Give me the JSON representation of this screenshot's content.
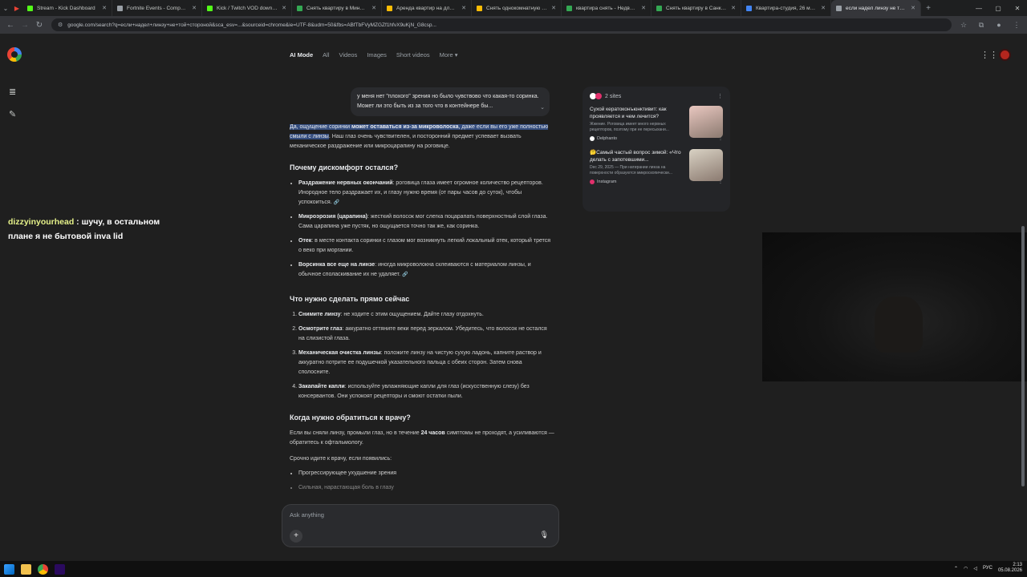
{
  "browser": {
    "tabs": [
      {
        "title": "Stream - Kick Dashboard",
        "color": "#53fc18"
      },
      {
        "title": "Fortnite Events - Competitiv",
        "color": "#9aa0a6"
      },
      {
        "title": "Kick / Twitch VOD download",
        "color": "#53fc18"
      },
      {
        "title": "Снять квартиру в Минске н",
        "color": "#34a853"
      },
      {
        "title": "Аренда квартир на длитель",
        "color": "#fbbc05"
      },
      {
        "title": "Снять однокомнатную квар",
        "color": "#fbbc05"
      },
      {
        "title": "квартира снять - Недвижим",
        "color": "#34a853"
      },
      {
        "title": "Снять квартиру в Санкт-Пе",
        "color": "#34a853"
      },
      {
        "title": "Квартира-студия, 26 м², 24",
        "color": "#4285f4"
      },
      {
        "title": "если надел линзу не той ст",
        "color": "#9aa0a6",
        "active": true
      }
    ],
    "url": "google.com/search?q=если+надел+линзу+не+той+стороной&sca_esv=...&sourceid=chrome&ie=UTF-8&udm=50&fbs=ABfTbFVyMZGZf1hfvX9uKjN_G8csp..."
  },
  "search": {
    "tabs": [
      "AI Mode",
      "All",
      "Videos",
      "Images",
      "Short videos",
      "More ▾"
    ]
  },
  "chat": {
    "user_query": "у меня нет \"плохого\" зрения но было чувствово что какая-то соринка. Может ли это быть из за того что в контейнере бы...",
    "intro_hl": "Да, ощущение соринки ",
    "intro_hl_bold": "может оставаться из-за микроволоска",
    "intro_hl2": ", даже если вы его уже полностью смыли с линзы",
    "intro_rest": ". Наш глаз очень чувствителен, и посторонний предмет успевает вызвать механическое раздражение или микроцарапину на роговице.",
    "h1": "Почему дискомфорт остался?",
    "reasons": [
      {
        "b": "Раздражение нервных окончаний",
        "t": ": роговица глаза имеет огромное количество рецепторов. Инородное тело раздражает их, и глазу нужно время (от пары часов до суток), чтобы успокоиться."
      },
      {
        "b": "Микроэрозия (царапина)",
        "t": ": жесткий волосок мог слегка поцарапать поверхностный слой глаза. Сама царапина уже пустяк, но ощущается точно так же, как соринка."
      },
      {
        "b": "Отек",
        "t": ": в месте контакта соринки с глазом мог возникнуть легкий локальный отек, который трется о веко при моргании."
      },
      {
        "b": "Ворсинка все еще на линзе",
        "t": ": иногда микроволокна склеиваются с материалом линзы, и обычное споласкивание их не удаляет."
      }
    ],
    "h2": "Что нужно сделать прямо сейчас",
    "steps": [
      {
        "b": "Снимите линзу",
        "t": ": не ходите с этим ощущением. Дайте глазу отдохнуть."
      },
      {
        "b": "Осмотрите глаз",
        "t": ": аккуратно оттяните веки перед зеркалом. Убедитесь, что волосок не остался на слизистой глаза."
      },
      {
        "b": "Механическая очистка линзы",
        "t": ": положите линзу на чистую сухую ладонь, капните раствор и аккуратно потрите ее подушечкой указательного пальца с обеих сторон. Затем снова сполосните."
      },
      {
        "b": "Закапайте капли",
        "t": ": используйте увлажняющие капли для глаз (искусственную слезу) без консервантов. Они успокоят рецепторы и смоют остатки пыли."
      }
    ],
    "h3": "Когда нужно обратиться к врачу?",
    "doctor_a": "Если вы сняли линзу, промыли глаз, но в течение ",
    "doctor_b": "24 часов",
    "doctor_c": " симптомы не проходят, а усиливаются — обратитесь к офтальмологу.",
    "urgent": "Срочно идите к врачу, если появились:",
    "urgent_items": [
      "Прогрессирующее ухудшение зрения",
      "Сильная, нарастающая боль в глазу"
    ]
  },
  "sources": {
    "count_label": "2 sites",
    "items": [
      {
        "title": "Сухой кератоконъюнктивит: как проявляется и чем лечится?",
        "snippet": "Жжение. Роговица имеет много нервных рецепторов, поэтому при ее пересыхани...",
        "site": "Delphanto",
        "thumb": "#e9c7c0",
        "dot": "#ffffff"
      },
      {
        "title": "🤔Самый частый вопрос зимой: «Что делать с запотевшими...",
        "snippet": "Dec 29, 2025 — При натирании линза на поверхности образуются микроскопически...",
        "site": "Instagram",
        "thumb": "#d9d2c4",
        "dot": "#e1306c"
      }
    ]
  },
  "overlay": {
    "name": "dizzyinyourhead",
    "line1": " : шучу, в остальном",
    "line2": "плане я не бытовой inva lid"
  },
  "ask": {
    "placeholder": "Ask anything"
  },
  "taskbar": {
    "lang": "РУС",
    "time": "2:13",
    "date": "05.08.2026"
  }
}
